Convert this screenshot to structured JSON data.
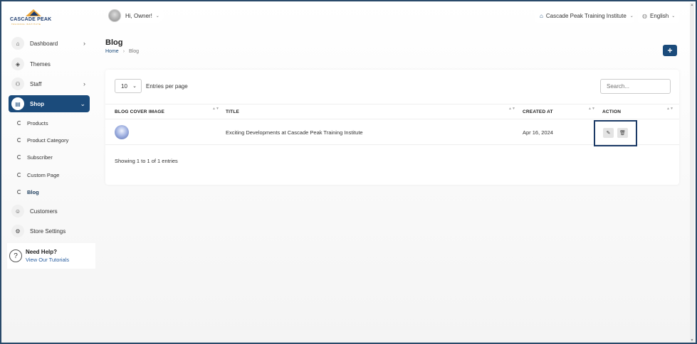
{
  "brand": {
    "name": "CASCADE PEAK",
    "tagline": "TRAINING INSTITUTE"
  },
  "sidebar": {
    "items": [
      {
        "label": "Dashboard",
        "icon": "home-icon",
        "chevron": "›"
      },
      {
        "label": "Themes",
        "icon": "palette-icon"
      },
      {
        "label": "Staff",
        "icon": "users-icon",
        "chevron": "›"
      },
      {
        "label": "Shop",
        "icon": "shop-icon",
        "chevron": "⌄",
        "active": true
      },
      {
        "label": "Customers",
        "icon": "user-icon"
      },
      {
        "label": "Store Settings",
        "icon": "gear-icon"
      }
    ],
    "sub_items": [
      "Products",
      "Product Category",
      "Subscriber",
      "Custom Page",
      "Blog"
    ],
    "help": {
      "title": "Need Help?",
      "link": "View Our Tutorials",
      "icon": "?"
    }
  },
  "header": {
    "greeting": "Hi, Owner!",
    "org": "Cascade Peak Training Institute",
    "language": "English",
    "chevron": "⌄",
    "org_icon": "⌂",
    "lang_icon": "◍"
  },
  "page": {
    "title": "Blog",
    "breadcrumb": {
      "home": "Home",
      "sep": "›",
      "current": "Blog"
    },
    "add_label": "+"
  },
  "table": {
    "entries_value": "10",
    "entries_label": "Entries per page",
    "search_placeholder": "Search...",
    "headers": [
      "BLOG COVER IMAGE",
      "TITLE",
      "CREATED AT",
      "ACTION"
    ],
    "sort_glyph": "▲▼",
    "rows": [
      {
        "title": "Exciting Developments at Cascade Peak Training Institute",
        "created_at": "Apr 16, 2024"
      }
    ],
    "actions": {
      "edit_icon": "✎",
      "delete_icon": "🗑"
    },
    "showing": "Showing 1 to 1 of 1 entries"
  },
  "colors": {
    "accent": "#1b4b7b",
    "highlight_border": "#1b3a66"
  }
}
